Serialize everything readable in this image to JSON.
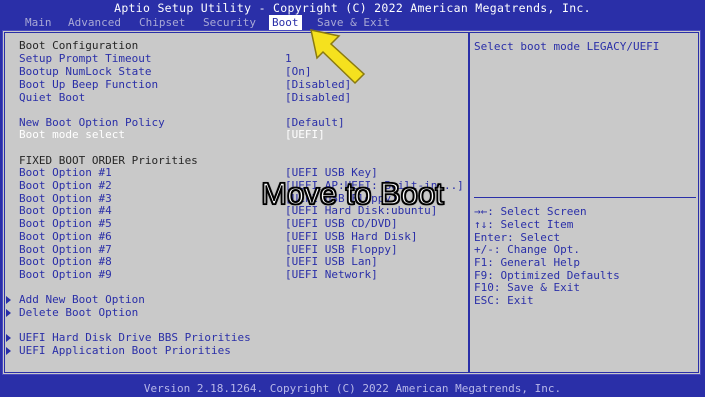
{
  "title": "Aptio Setup Utility - Copyright (C) 2022 American Megatrends, Inc.",
  "tabs": [
    {
      "label": "Main"
    },
    {
      "label": "Advanced"
    },
    {
      "label": "Chipset"
    },
    {
      "label": "Security"
    },
    {
      "label": "Boot",
      "active": true
    },
    {
      "label": "Save & Exit"
    }
  ],
  "main": {
    "boot_configuration": "Boot Configuration",
    "settings": [
      {
        "label": "Setup Prompt Timeout",
        "value": "1"
      },
      {
        "label": "Bootup NumLock State",
        "value": "[On]"
      },
      {
        "label": "Boot Up Beep Function",
        "value": "[Disabled]"
      },
      {
        "label": "Quiet Boot",
        "value": "[Disabled]"
      }
    ],
    "policy": {
      "label": "New Boot Option Policy",
      "value": "[Default]"
    },
    "mode_select": {
      "label": "Boot mode select",
      "value": "[UEFI]"
    },
    "fixed_header": "FIXED BOOT ORDER Priorities",
    "boot_options": [
      {
        "label": "Boot Option #1",
        "value": "[UEFI USB Key]"
      },
      {
        "label": "Boot Option #2",
        "value": "[UEFI AP:UEFI: Built-in...]"
      },
      {
        "label": "Boot Option #3",
        "value": "[UEFI USB Floppy]"
      },
      {
        "label": "Boot Option #4",
        "value": "[UEFI Hard Disk:ubuntu]"
      },
      {
        "label": "Boot Option #5",
        "value": "[UEFI USB CD/DVD]"
      },
      {
        "label": "Boot Option #6",
        "value": "[UEFI USB Hard Disk]"
      },
      {
        "label": "Boot Option #7",
        "value": "[UEFI USB Floppy]"
      },
      {
        "label": "Boot Option #8",
        "value": "[UEFI USB Lan]"
      },
      {
        "label": "Boot Option #9",
        "value": "[UEFI Network]"
      }
    ],
    "submenus": [
      {
        "label": "Add New Boot Option"
      },
      {
        "label": "Delete Boot Option"
      },
      {
        "label": "UEFI Hard Disk Drive BBS Priorities"
      },
      {
        "label": "UEFI Application Boot Priorities"
      }
    ]
  },
  "help": {
    "description": "Select boot mode LEGACY/UEFI",
    "keys": [
      "→←: Select Screen",
      "↑↓: Select Item",
      "Enter: Select",
      "+/-: Change Opt.",
      "F1: General Help",
      "F9: Optimized Defaults",
      "F10: Save & Exit",
      "ESC: Exit"
    ]
  },
  "footer": "Version 2.18.1264. Copyright (C) 2022 American Megatrends, Inc.",
  "overlay_caption": "Move to Boot",
  "colors": {
    "bios_blue": "#2a2fa8",
    "panel_gray": "#c9c9c9",
    "arrow_yellow": "#f5e11e"
  }
}
